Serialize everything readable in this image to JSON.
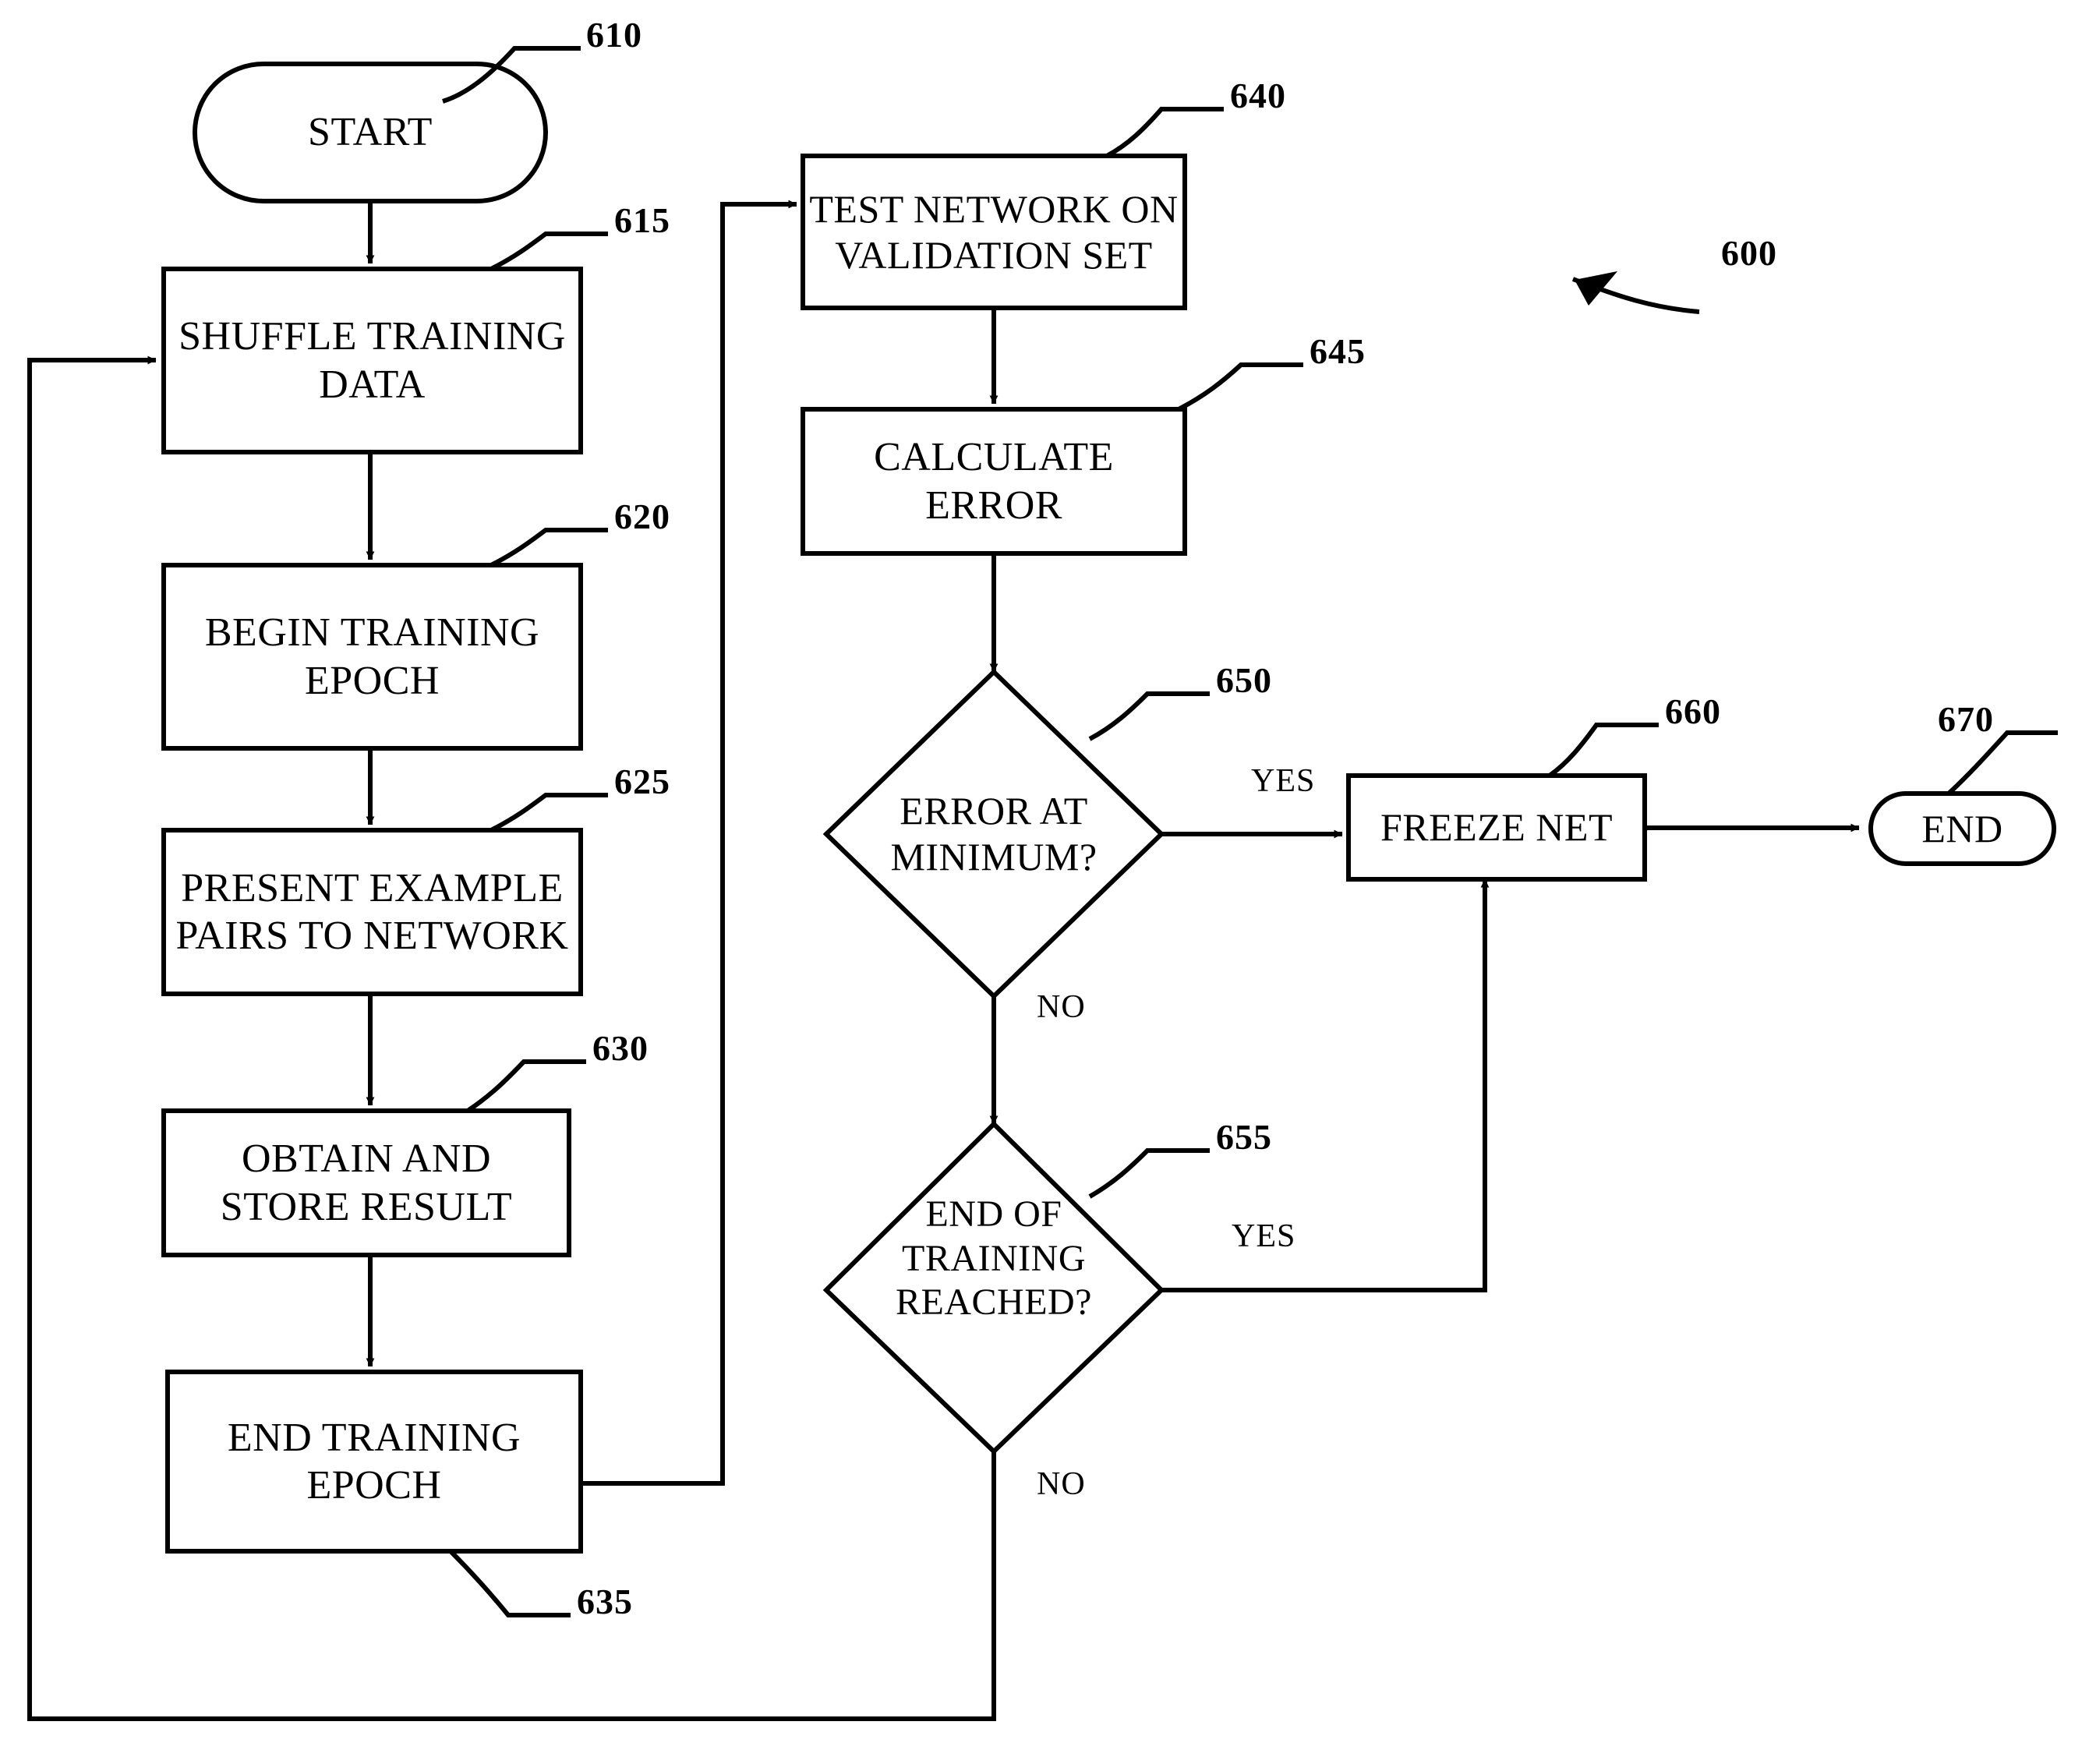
{
  "figure": {
    "number": "600",
    "type": "flowchart",
    "description": "Neural network training flowchart"
  },
  "nodes": [
    {
      "id": "start",
      "shape": "terminator",
      "label": "START",
      "ref": "610"
    },
    {
      "id": "shuffle",
      "shape": "process",
      "label": "SHUFFLE TRAINING\nDATA",
      "ref": "615"
    },
    {
      "id": "begin",
      "shape": "process",
      "label": "BEGIN TRAINING\nEPOCH",
      "ref": "620"
    },
    {
      "id": "present",
      "shape": "process",
      "label": "PRESENT EXAMPLE\nPAIRS TO NETWORK",
      "ref": "625"
    },
    {
      "id": "obtain",
      "shape": "process",
      "label": "OBTAIN AND\nSTORE RESULT",
      "ref": "630"
    },
    {
      "id": "endepoch",
      "shape": "process",
      "label": "END TRAINING\nEPOCH",
      "ref": "635"
    },
    {
      "id": "test",
      "shape": "process",
      "label": "TEST NETWORK ON\nVALIDATION SET",
      "ref": "640"
    },
    {
      "id": "calcerr",
      "shape": "process",
      "label": "CALCULATE\nERROR",
      "ref": "645"
    },
    {
      "id": "errmin",
      "shape": "decision",
      "label": "ERROR AT\nMINIMUM?",
      "ref": "650"
    },
    {
      "id": "endtrain",
      "shape": "decision",
      "label": "END OF\nTRAINING\nREACHED?",
      "ref": "655"
    },
    {
      "id": "freeze",
      "shape": "process",
      "label": "FREEZE NET",
      "ref": "660"
    },
    {
      "id": "end",
      "shape": "terminator",
      "label": "END",
      "ref": "670"
    }
  ],
  "node_labels": {
    "start": "START",
    "shuffle_line1": "SHUFFLE TRAINING",
    "shuffle_line2": "DATA",
    "begin_line1": "BEGIN TRAINING",
    "begin_line2": "EPOCH",
    "present_line1": "PRESENT EXAMPLE",
    "present_line2": "PAIRS TO NETWORK",
    "obtain_line1": "OBTAIN AND",
    "obtain_line2": "STORE RESULT",
    "endepoch_line1": "END TRAINING",
    "endepoch_line2": "EPOCH",
    "test_line1": "TEST NETWORK ON",
    "test_line2": "VALIDATION SET",
    "calcerr_line1": "CALCULATE",
    "calcerr_line2": "ERROR",
    "errmin_line1": "ERROR AT",
    "errmin_line2": "MINIMUM?",
    "endtrain_line1": "END OF",
    "endtrain_line2": "TRAINING",
    "endtrain_line3": "REACHED?",
    "freeze": "FREEZE NET",
    "end": "END"
  },
  "reference_numerals": {
    "figure": "600",
    "start": "610",
    "shuffle": "615",
    "begin": "620",
    "present": "625",
    "obtain": "630",
    "endepoch": "635",
    "test": "640",
    "calcerr": "645",
    "errmin": "650",
    "endtrain": "655",
    "freeze": "660",
    "end": "670"
  },
  "edge_labels": {
    "errmin_yes": "YES",
    "errmin_no": "NO",
    "endtrain_yes": "YES",
    "endtrain_no": "NO"
  },
  "edges": [
    {
      "from": "start",
      "to": "shuffle",
      "label": ""
    },
    {
      "from": "shuffle",
      "to": "begin",
      "label": ""
    },
    {
      "from": "begin",
      "to": "present",
      "label": ""
    },
    {
      "from": "present",
      "to": "obtain",
      "label": ""
    },
    {
      "from": "obtain",
      "to": "endepoch",
      "label": ""
    },
    {
      "from": "endepoch",
      "to": "test",
      "label": ""
    },
    {
      "from": "test",
      "to": "calcerr",
      "label": ""
    },
    {
      "from": "calcerr",
      "to": "errmin",
      "label": ""
    },
    {
      "from": "errmin",
      "to": "freeze",
      "label": "YES"
    },
    {
      "from": "errmin",
      "to": "endtrain",
      "label": "NO"
    },
    {
      "from": "endtrain",
      "to": "freeze",
      "label": "YES"
    },
    {
      "from": "endtrain",
      "to": "shuffle",
      "label": "NO"
    },
    {
      "from": "freeze",
      "to": "end",
      "label": ""
    }
  ],
  "colors": {
    "stroke": "#000000",
    "fill": "#ffffff",
    "text": "#000000"
  }
}
